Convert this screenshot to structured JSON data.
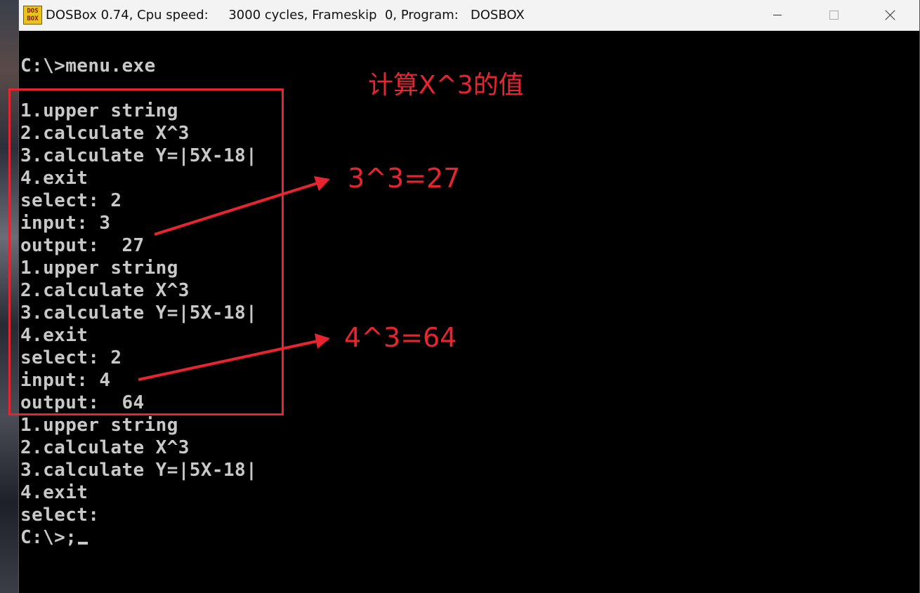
{
  "window": {
    "title": "DOSBox 0.74, Cpu speed:     3000 cycles, Frameskip  0, Program:   DOSBOX",
    "icon": "dosbox-icon",
    "icon_text_top": "DOS",
    "icon_text_bottom": "BOX"
  },
  "terminal": {
    "lines": [
      "C:\\>menu.exe",
      "",
      "1.upper string",
      "2.calculate X^3",
      "3.calculate Y=|5X-18|",
      "4.exit",
      "select: 2",
      "input: 3",
      "output:  27",
      "1.upper string",
      "2.calculate X^3",
      "3.calculate Y=|5X-18|",
      "4.exit",
      "select: 2",
      "input: 4",
      "output:  64",
      "1.upper string",
      "2.calculate X^3",
      "3.calculate Y=|5X-18|",
      "4.exit",
      "select:",
      "C:\\>;"
    ]
  },
  "annotations": {
    "title": "计算X^3的值",
    "result1": "3^3=27",
    "result2": "4^3=64",
    "color": "#e8252f"
  }
}
